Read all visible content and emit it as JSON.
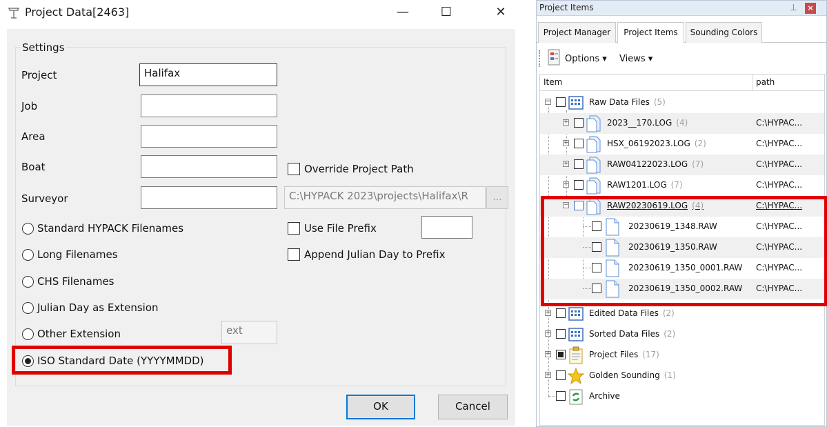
{
  "dialog": {
    "title": "Project Data[2463]",
    "window_controls": {
      "minimize": "—",
      "maximize": "☐",
      "close": "✕"
    },
    "group_label": "Settings",
    "fields": {
      "project_label": "Project",
      "project_value": "Halifax",
      "job_label": "Job",
      "job_value": "",
      "area_label": "Area",
      "area_value": "",
      "boat_label": "Boat",
      "boat_value": "",
      "surveyor_label": "Surveyor",
      "surveyor_value": "",
      "project_path_value": "C:\\HYPACK 2023\\projects\\Halifax\\R",
      "browse_label": "...",
      "ext_placeholder": "ext",
      "prefix_value": ""
    },
    "checkboxes": {
      "override_path": "Override Project Path",
      "use_prefix": "Use File Prefix",
      "append_julian": "Append Julian Day to Prefix"
    },
    "radios": {
      "standard": "Standard HYPACK Filenames",
      "long": "Long Filenames",
      "chs": "CHS Filenames",
      "julian": "Julian Day as Extension",
      "other": "Other Extension",
      "iso": "ISO Standard Date (YYYYMMDD)"
    },
    "selected_radio": "iso",
    "buttons": {
      "ok": "OK",
      "cancel": "Cancel"
    }
  },
  "panel": {
    "title": "Project Items",
    "tabs": [
      "Project Manager",
      "Project Items",
      "Sounding Colors"
    ],
    "active_tab": "Project Items",
    "toolbar": {
      "options": "Options ▾",
      "views": "Views ▾"
    },
    "columns": {
      "item": "Item",
      "path": "path"
    },
    "rows": [
      {
        "label": "Raw Data Files",
        "count": "(5)",
        "path": ""
      },
      {
        "label": "2023__170.LOG",
        "count": "(4)",
        "path": "C:\\HYPAC..."
      },
      {
        "label": "HSX_06192023.LOG",
        "count": "(2)",
        "path": "C:\\HYPAC..."
      },
      {
        "label": "RAW04122023.LOG",
        "count": "(7)",
        "path": "C:\\HYPAC..."
      },
      {
        "label": "RAW1201.LOG",
        "count": "(7)",
        "path": "C:\\HYPAC..."
      },
      {
        "label": "RAW20230619.LOG",
        "count": "(4)",
        "path": "C:\\HYPAC..."
      },
      {
        "label": "20230619_1348.RAW",
        "count": "",
        "path": "C:\\HYPAC..."
      },
      {
        "label": "20230619_1350.RAW",
        "count": "",
        "path": "C:\\HYPAC..."
      },
      {
        "label": "20230619_1350_0001.RAW",
        "count": "",
        "path": "C:\\HYPAC..."
      },
      {
        "label": "20230619_1350_0002.RAW",
        "count": "",
        "path": "C:\\HYPAC..."
      },
      {
        "label": "Edited Data Files",
        "count": "(2)",
        "path": ""
      },
      {
        "label": "Sorted Data Files",
        "count": "(2)",
        "path": ""
      },
      {
        "label": "Project Files",
        "count": "(17)",
        "path": ""
      },
      {
        "label": "Golden Sounding",
        "count": "(1)",
        "path": ""
      },
      {
        "label": "Archive",
        "count": "",
        "path": ""
      }
    ]
  },
  "colors": {
    "highlight": "#e00000",
    "accent": "#0078d7"
  }
}
